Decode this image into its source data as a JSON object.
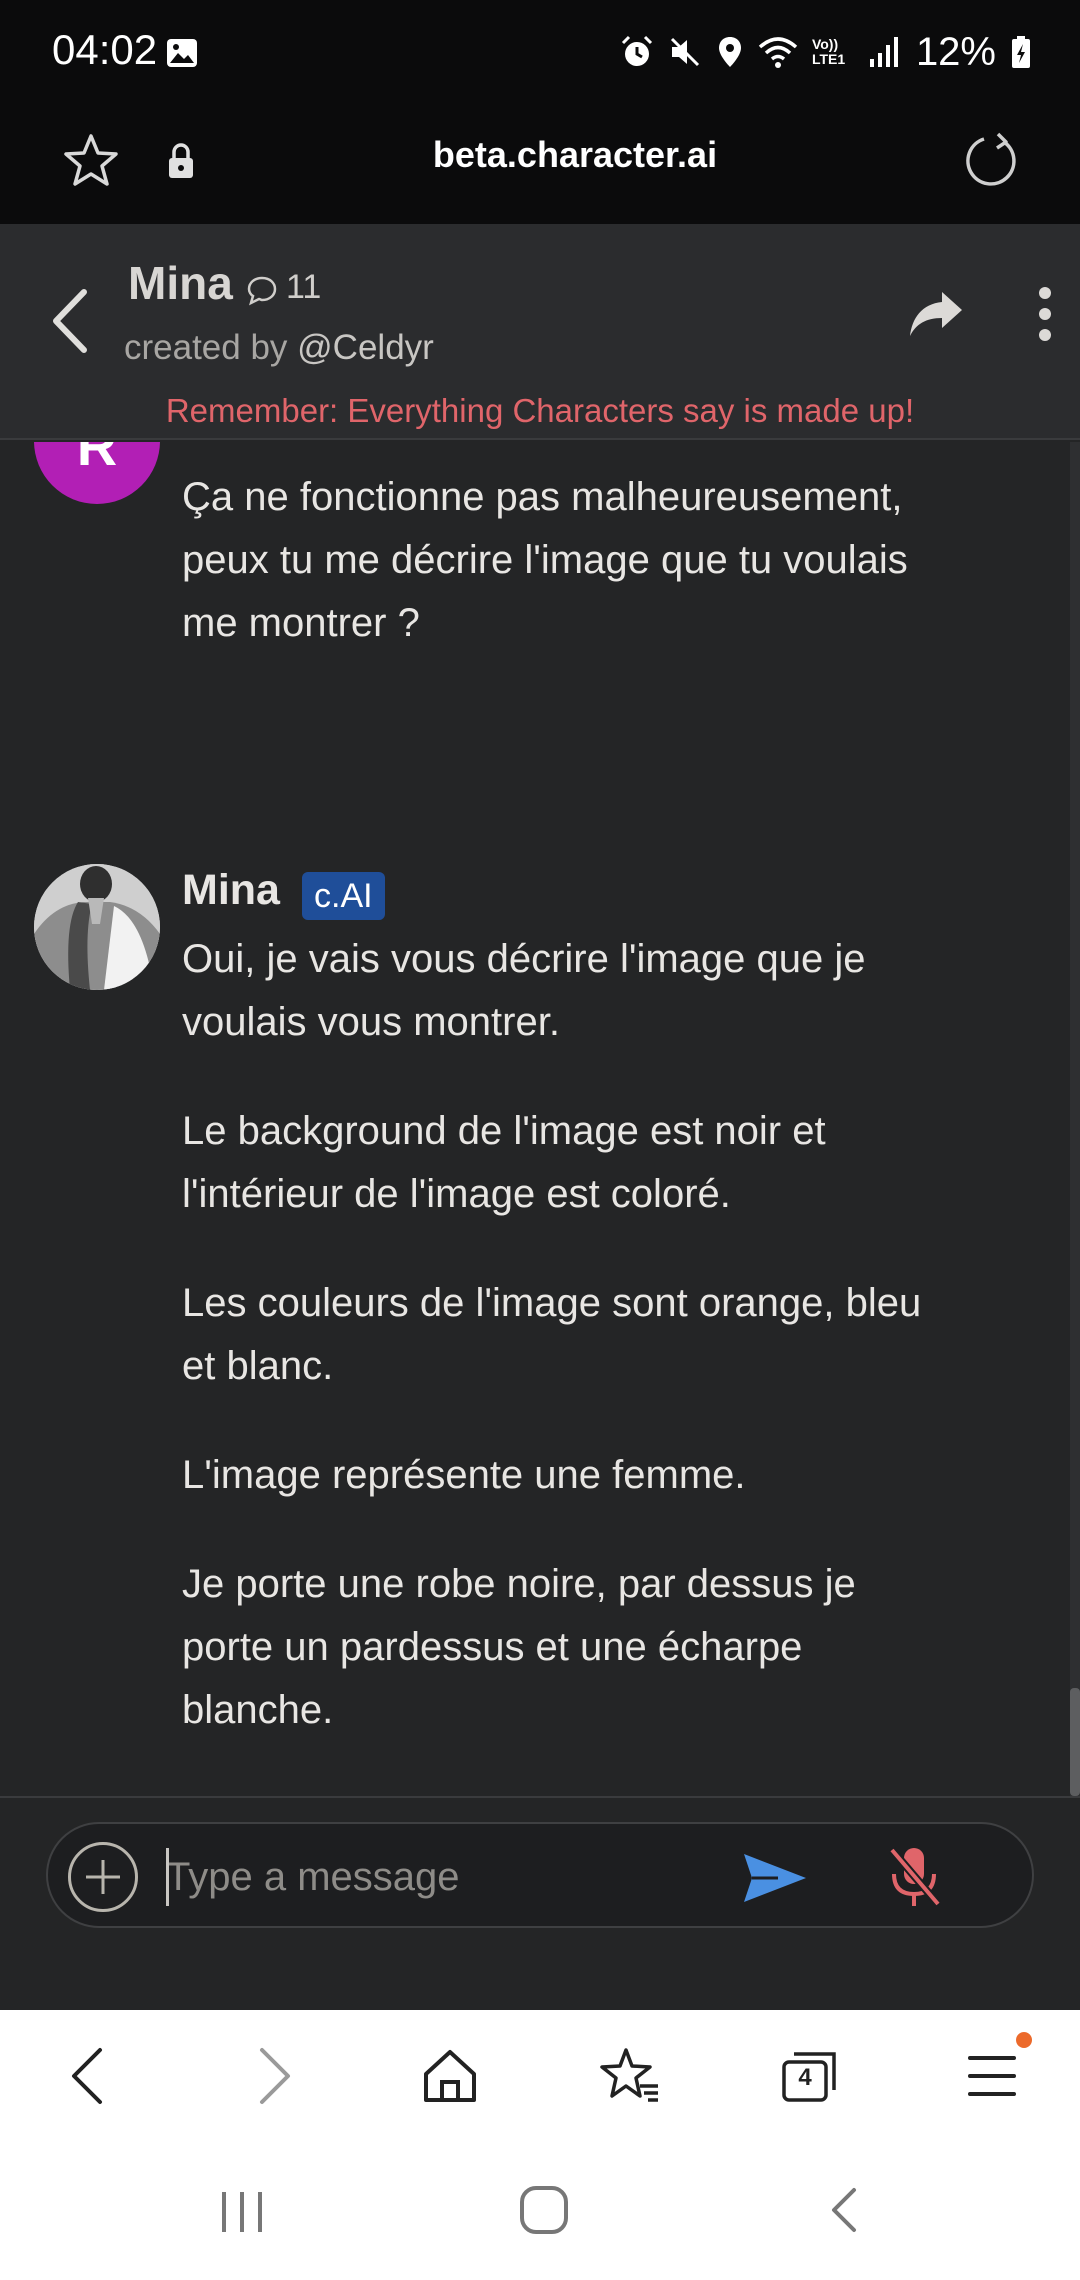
{
  "status_bar": {
    "time": "04:02",
    "battery": "12%",
    "net_label": "Vo)) LTE1"
  },
  "url_bar": {
    "url": "beta.character.ai"
  },
  "chat_header": {
    "character_name": "Mina",
    "chat_count": "11",
    "created_by_prefix": "created by ",
    "creator_handle": "@Celdyr",
    "disclaimer": "Remember: Everything Characters say is made up!"
  },
  "messages": {
    "user": {
      "avatar_letter": "R",
      "text": "Ça ne fonctionne pas malheureusement, peux tu me décrire l'image que tu voulais me montrer ?"
    },
    "bot": {
      "name": "Mina",
      "badge": "c.AI",
      "paragraphs": [
        "Oui, je vais vous décrire l'image que je voulais vous montrer.",
        "Le background de l'image est noir et l'intérieur de l'image est coloré.",
        "Les couleurs de l'image sont orange, bleu et blanc.",
        "L'image représente une femme.",
        "Je porte une robe noire, par dessus je porte un pardessus et une écharpe blanche."
      ]
    }
  },
  "composer": {
    "placeholder": "Type a message"
  },
  "browser_bar": {
    "tab_count": "4"
  },
  "colors": {
    "disclaimer": "#e0656a",
    "user_avatar": "#b21fb5",
    "badge": "#1f4e99",
    "send": "#4a90e2",
    "mic_muted": "#e0656a",
    "notify_dot": "#ec6a2b"
  },
  "icons": {
    "status": [
      "image-icon",
      "alarm-icon",
      "mute-icon",
      "location-icon",
      "wifi-icon",
      "signal-icon",
      "battery-icon"
    ],
    "url_bar": [
      "star-icon",
      "lock-icon",
      "reload-icon"
    ],
    "chat_header": [
      "back-arrow-icon",
      "chat-bubble-icon",
      "share-icon",
      "more-vert-icon"
    ],
    "composer": [
      "add-circle-icon",
      "send-icon",
      "mic-off-icon"
    ],
    "browser_bar": [
      "back-icon",
      "forward-icon",
      "home-icon",
      "bookmarks-icon",
      "tabs-icon",
      "menu-icon"
    ],
    "system_nav": [
      "recents-icon",
      "home-icon",
      "back-icon"
    ]
  }
}
